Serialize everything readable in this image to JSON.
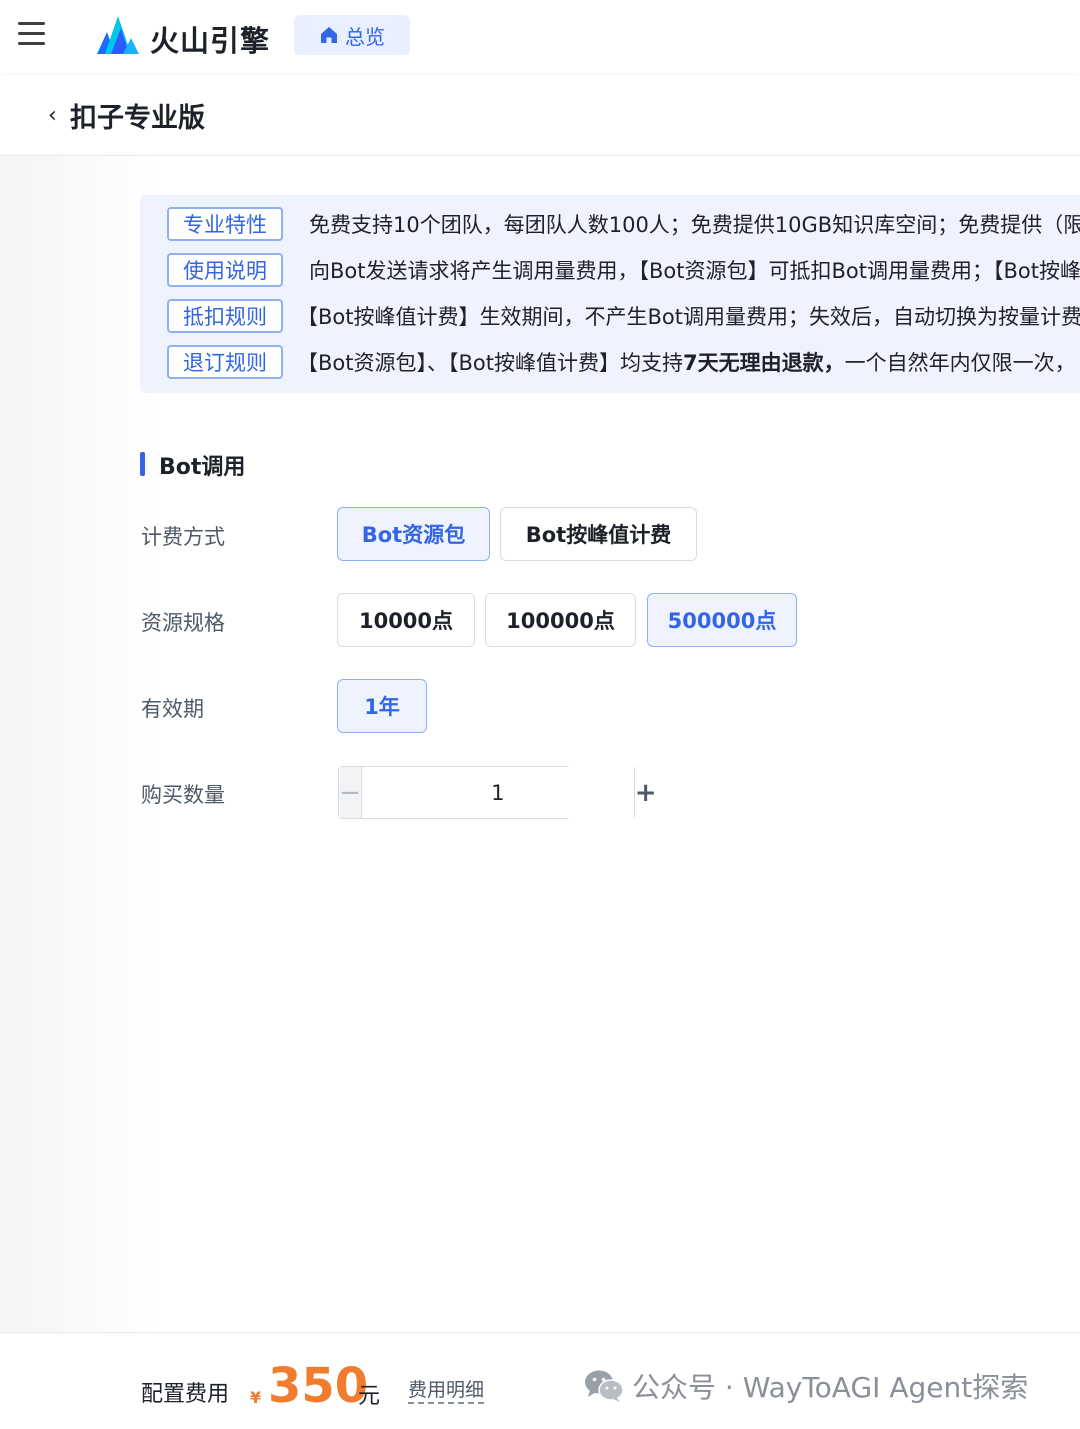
{
  "header": {
    "brand": "火山引擎",
    "overview_label": "总览"
  },
  "page": {
    "title": "扣子专业版"
  },
  "info": [
    {
      "tag": "专业特性",
      "text": "免费支持10个团队，每团队人数100人；免费提供10GB知识库空间；免费提供（限"
    },
    {
      "tag": "使用说明",
      "text": "向Bot发送请求将产生调用量费用，【Bot资源包】可抵扣Bot调用量费用；【Bot按峰"
    },
    {
      "tag": "抵扣规则",
      "text": "【Bot按峰值计费】生效期间，不产生Bot调用量费用；失效后，自动切换为按量计费"
    },
    {
      "tag": "退订规则",
      "text_before": "【Bot资源包】、【Bot按峰值计费】均支持",
      "text_bold": "7天无理由退款，",
      "text_after": "一个自然年内仅限一次，"
    }
  ],
  "section": {
    "title": "Bot调用"
  },
  "form": {
    "billing_label": "计费方式",
    "billing_options": [
      "Bot资源包",
      "Bot按峰值计费"
    ],
    "billing_selected": "Bot资源包",
    "spec_label": "资源规格",
    "spec_options": [
      "10000点",
      "100000点",
      "500000点"
    ],
    "spec_selected": "500000点",
    "validity_label": "有效期",
    "validity_options": [
      "1年"
    ],
    "validity_selected": "1年",
    "quantity_label": "购买数量",
    "quantity_value": "1",
    "minus_symbol": "−",
    "plus_symbol": "+"
  },
  "footer": {
    "fee_label": "配置费用",
    "currency_symbol": "¥",
    "price": "350",
    "unit": "元",
    "detail_link": "费用明细",
    "watermark": "公众号 · WayToAGI Agent探索"
  },
  "colors": {
    "accent": "#3366e6",
    "price": "#f07d2e",
    "info_bg": "#eef3fd"
  },
  "icons": {
    "menu": "hamburger-icon",
    "home": "home-icon",
    "back": "chevron-left-icon",
    "wechat": "wechat-icon"
  }
}
